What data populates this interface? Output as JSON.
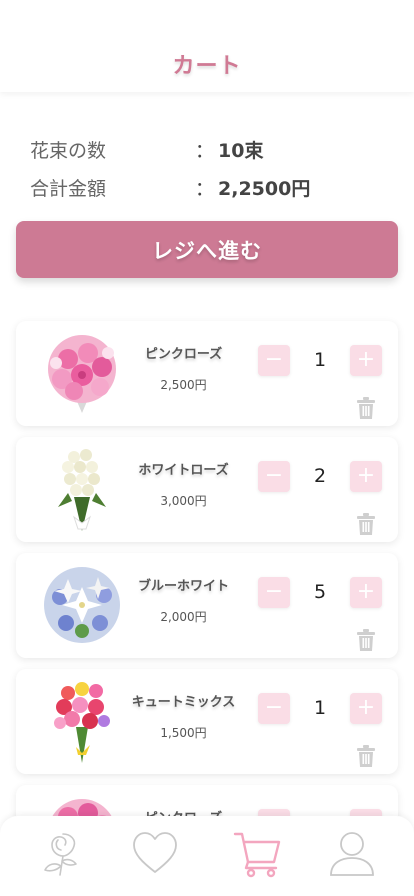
{
  "header": {
    "title": "カート"
  },
  "summary": {
    "bouquet_count_label": "花束の数",
    "bouquet_count_value": "10束",
    "total_label": "合計金額",
    "total_value": "2,2500円",
    "colon": "："
  },
  "checkout": {
    "label": "レジへ進む"
  },
  "qty_controls": {
    "minus": "−",
    "plus": "+"
  },
  "cart": {
    "items": [
      {
        "name": "ピンクローズ",
        "price": "2,500円",
        "quantity": "1"
      },
      {
        "name": "ホワイトローズ",
        "price": "3,000円",
        "quantity": "2"
      },
      {
        "name": "ブルーホワイト",
        "price": "2,000円",
        "quantity": "5"
      },
      {
        "name": "キュートミックス",
        "price": "1,500円",
        "quantity": "1"
      },
      {
        "name": "ピンクローズ",
        "price": "",
        "quantity": ""
      }
    ]
  },
  "tabbar": {
    "tabs": [
      {
        "icon": "rose-icon",
        "active": false
      },
      {
        "icon": "heart-icon",
        "active": false
      },
      {
        "icon": "cart-icon",
        "active": true
      },
      {
        "icon": "user-icon",
        "active": false
      }
    ]
  },
  "colors": {
    "accent": "#cd7a94",
    "accent_light": "#fadde6",
    "title": "#d07a94",
    "tab_inactive": "#c8c8c8",
    "tab_active": "#f3a6bf"
  }
}
